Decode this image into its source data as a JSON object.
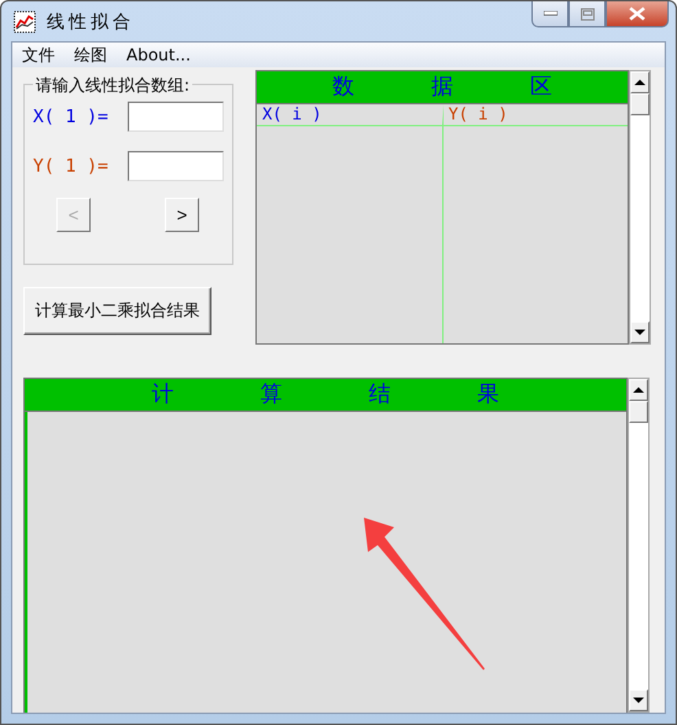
{
  "window": {
    "title": "线性拟合"
  },
  "menu": [
    "文件",
    "绘图",
    "About..."
  ],
  "input_group": {
    "title": "请输入线性拟合数组:",
    "x_label": "X( 1 )=",
    "y_label": "Y( 1 )=",
    "prev": {
      "label": "<",
      "disabled": true
    },
    "next": {
      "label": ">",
      "disabled": false
    }
  },
  "compute_button": "计算最小二乘拟合结果",
  "data_grid": {
    "header_chars": [
      "数",
      "据",
      "区"
    ],
    "columns": [
      "X( i )",
      "Y( i )"
    ]
  },
  "results": {
    "header_chars": [
      "计",
      "算",
      "结",
      "果"
    ]
  }
}
